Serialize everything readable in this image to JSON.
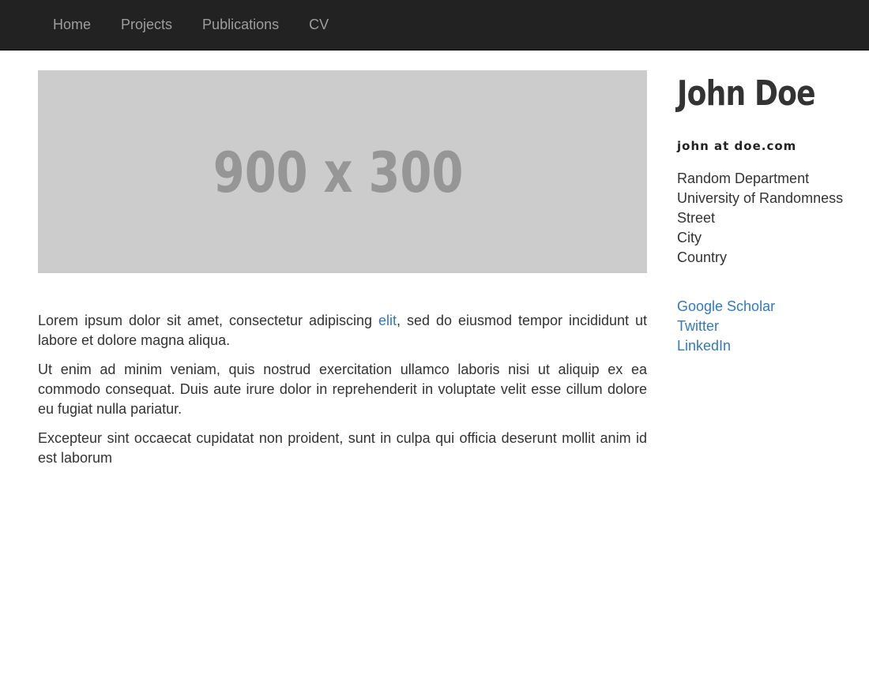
{
  "nav": {
    "items": [
      "Home",
      "Projects",
      "Publications",
      "CV"
    ]
  },
  "hero": {
    "placeholder_text": "900 x 300"
  },
  "content": {
    "p1_before": "Lorem ipsum dolor sit amet, consectetur adipiscing ",
    "p1_link": "elit",
    "p1_after": ", sed do eiusmod tempor incididunt ut labore et dolore magna aliqua.",
    "p2": "Ut enim ad minim veniam, quis nostrud exercitation ullamco laboris nisi ut aliquip ex ea commodo consequat. Duis aute irure dolor in reprehenderit in voluptate velit esse cillum dolore eu fugiat nulla pariatur.",
    "p3": "Excepteur sint occaecat cupidatat non proident, sunt in culpa qui officia deserunt mollit anim id est laborum"
  },
  "sidebar": {
    "name": "John Doe",
    "email": "john at doe.com",
    "address": [
      "Random Department",
      "University of Randomness",
      "Street",
      "City",
      "Country"
    ],
    "links": [
      "Google Scholar",
      "Twitter",
      "LinkedIn"
    ]
  },
  "colors": {
    "navbar_bg": "#222222",
    "nav_text": "#9d9d9d",
    "link": "#337ab7",
    "placeholder_bg": "#cccccc",
    "placeholder_text": "#969696",
    "body_text": "#333333"
  }
}
